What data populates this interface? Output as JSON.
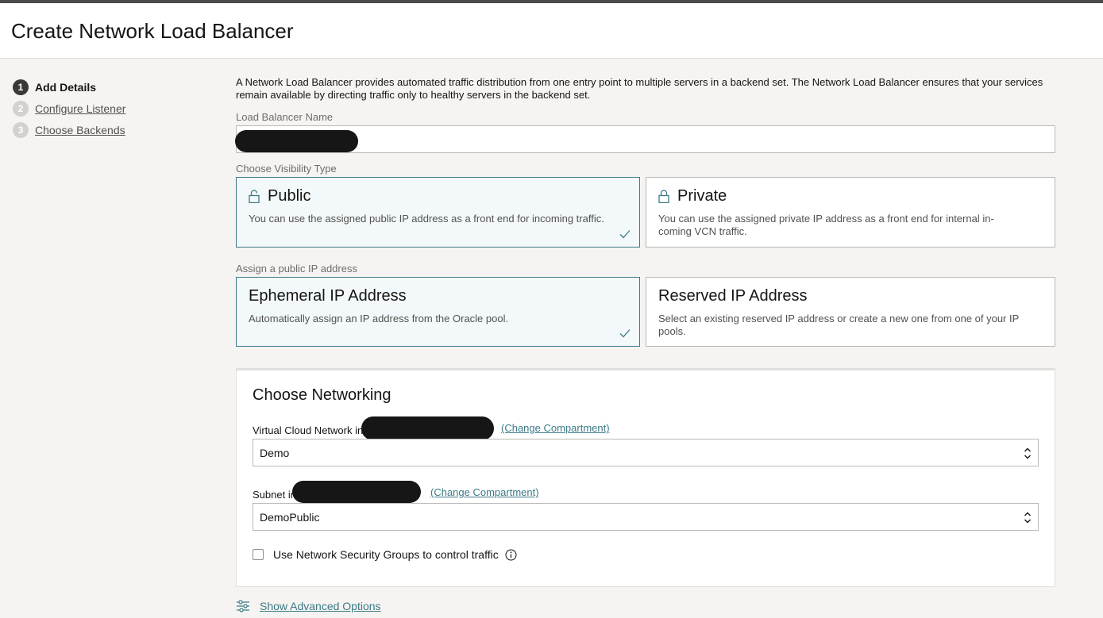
{
  "header": {
    "title": "Create Network Load Balancer"
  },
  "steps": [
    {
      "num": "1",
      "label": "Add Details"
    },
    {
      "num": "2",
      "label": "Configure Listener"
    },
    {
      "num": "3",
      "label": "Choose Backends"
    }
  ],
  "intro": "A Network Load Balancer provides automated traffic distribution from one entry point to multiple servers in a backend set. The Network Load Balancer ensures that your services remain available by directing traffic only to healthy servers in the backend set.",
  "name_field": {
    "label": "Load Balancer Name",
    "value": ""
  },
  "visibility": {
    "label": "Choose Visibility Type",
    "options": [
      {
        "title": "Public",
        "desc": "You can use the assigned public IP address as a front end for incoming traffic.",
        "selected": true
      },
      {
        "title": "Private",
        "desc": "You can use the assigned private IP address as a front end for internal in-coming VCN traffic.",
        "selected": false
      }
    ]
  },
  "ip_assignment": {
    "label": "Assign a public IP address",
    "options": [
      {
        "title": "Ephemeral IP Address",
        "desc": "Automatically assign an IP address from the Oracle pool.",
        "selected": true
      },
      {
        "title": "Reserved IP Address",
        "desc": "Select an existing reserved IP address or create a new one from one of your IP pools.",
        "selected": false
      }
    ]
  },
  "networking": {
    "title": "Choose Networking",
    "vcn_label": "Virtual Cloud Network in",
    "vcn_value": "Demo",
    "subnet_label": "Subnet in",
    "subnet_value": "DemoPublic",
    "change_compartment": "(Change Compartment)",
    "nsg_label": "Use Network Security Groups to control traffic",
    "nsg_checked": false
  },
  "advanced_label": "Show Advanced Options",
  "colors": {
    "accent": "#3c7a86",
    "selected_bg": "#f3f9fa",
    "active_step": "#3a3936"
  }
}
